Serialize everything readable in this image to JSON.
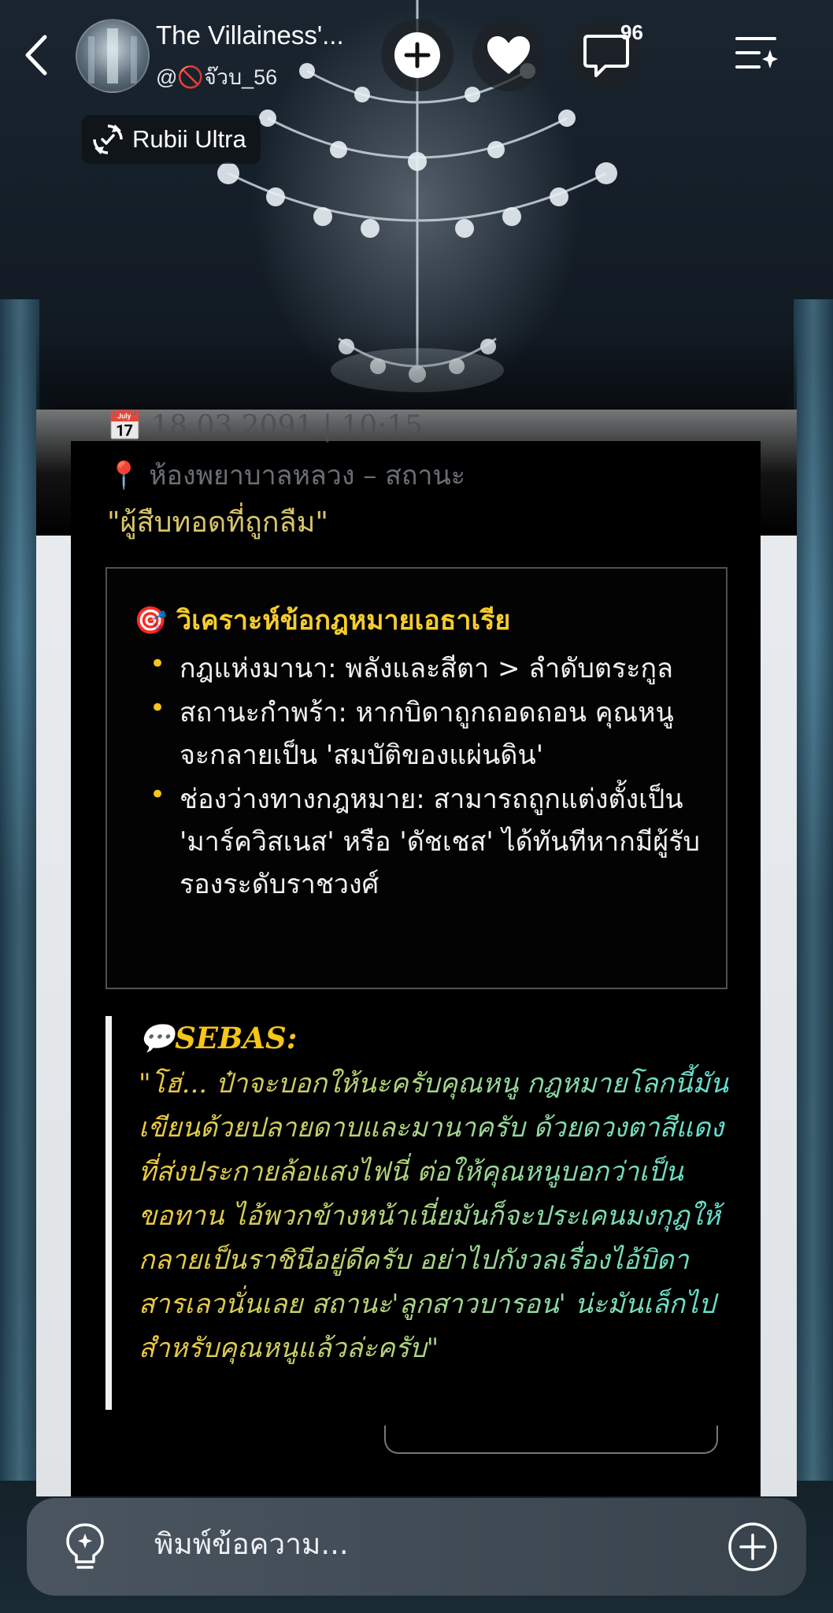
{
  "header": {
    "title": "The Villainess'...",
    "handle": "@🚫จ๊วบ_56",
    "comment_count": "96",
    "badge_label": "Rubii Ultra"
  },
  "message": {
    "date_line": "📅 18.03.2091 | 10:15",
    "location_line": "📍 ห้องพยาบาลหลวง – สถานะ",
    "quote_title": "\"ผู้สืบทอดที่ถูกลืม\"",
    "law_box": {
      "heading": "🎯 วิเคราะห์ข้อกฎหมายเอธาเรีย",
      "items": [
        "กฎแห่งมานา: พลังและสีตา > ลำดับตระกูล",
        "สถานะกำพร้า: หากบิดาถูกถอดถอน คุณหนูจะกลายเป็น 'สมบัติของแผ่นดิน'",
        "ช่องว่างทางกฎหมาย: สามารถถูกแต่งตั้งเป็น 'มาร์ควิสเนส' หรือ 'ดัชเชส' ได้ทันทีหากมีผู้รับรองระดับราชวงศ์"
      ]
    },
    "sebas": {
      "name": "💬SEBAS:",
      "text": "\"โฮ่... ป๋าจะบอกให้นะครับคุณหนู กฎหมายโลกนี้มันเขียนด้วยปลายดาบและมานาครับ ด้วยดวงตาสีแดงที่ส่งประกายล้อแสงไฟนี่ ต่อให้คุณหนูบอกว่าเป็นขอทาน ไอ้พวกข้างหน้าเนี่ยมันก็จะประเคนมงกุฎให้กลายเป็นราชินีอยู่ดีครับ อย่าไปกังวลเรื่องไอ้บิดาสารเลวนั่นเลย สถานะ'ลูกสาวบารอน' น่ะมันเล็กไปสำหรับคุณหนูแล้วล่ะครับ\""
    }
  },
  "input": {
    "placeholder": "พิมพ์ข้อความ..."
  },
  "colors": {
    "accent_yellow": "#f5c518",
    "accent_teal": "#5ee0d4",
    "card_bg": "#000000"
  }
}
